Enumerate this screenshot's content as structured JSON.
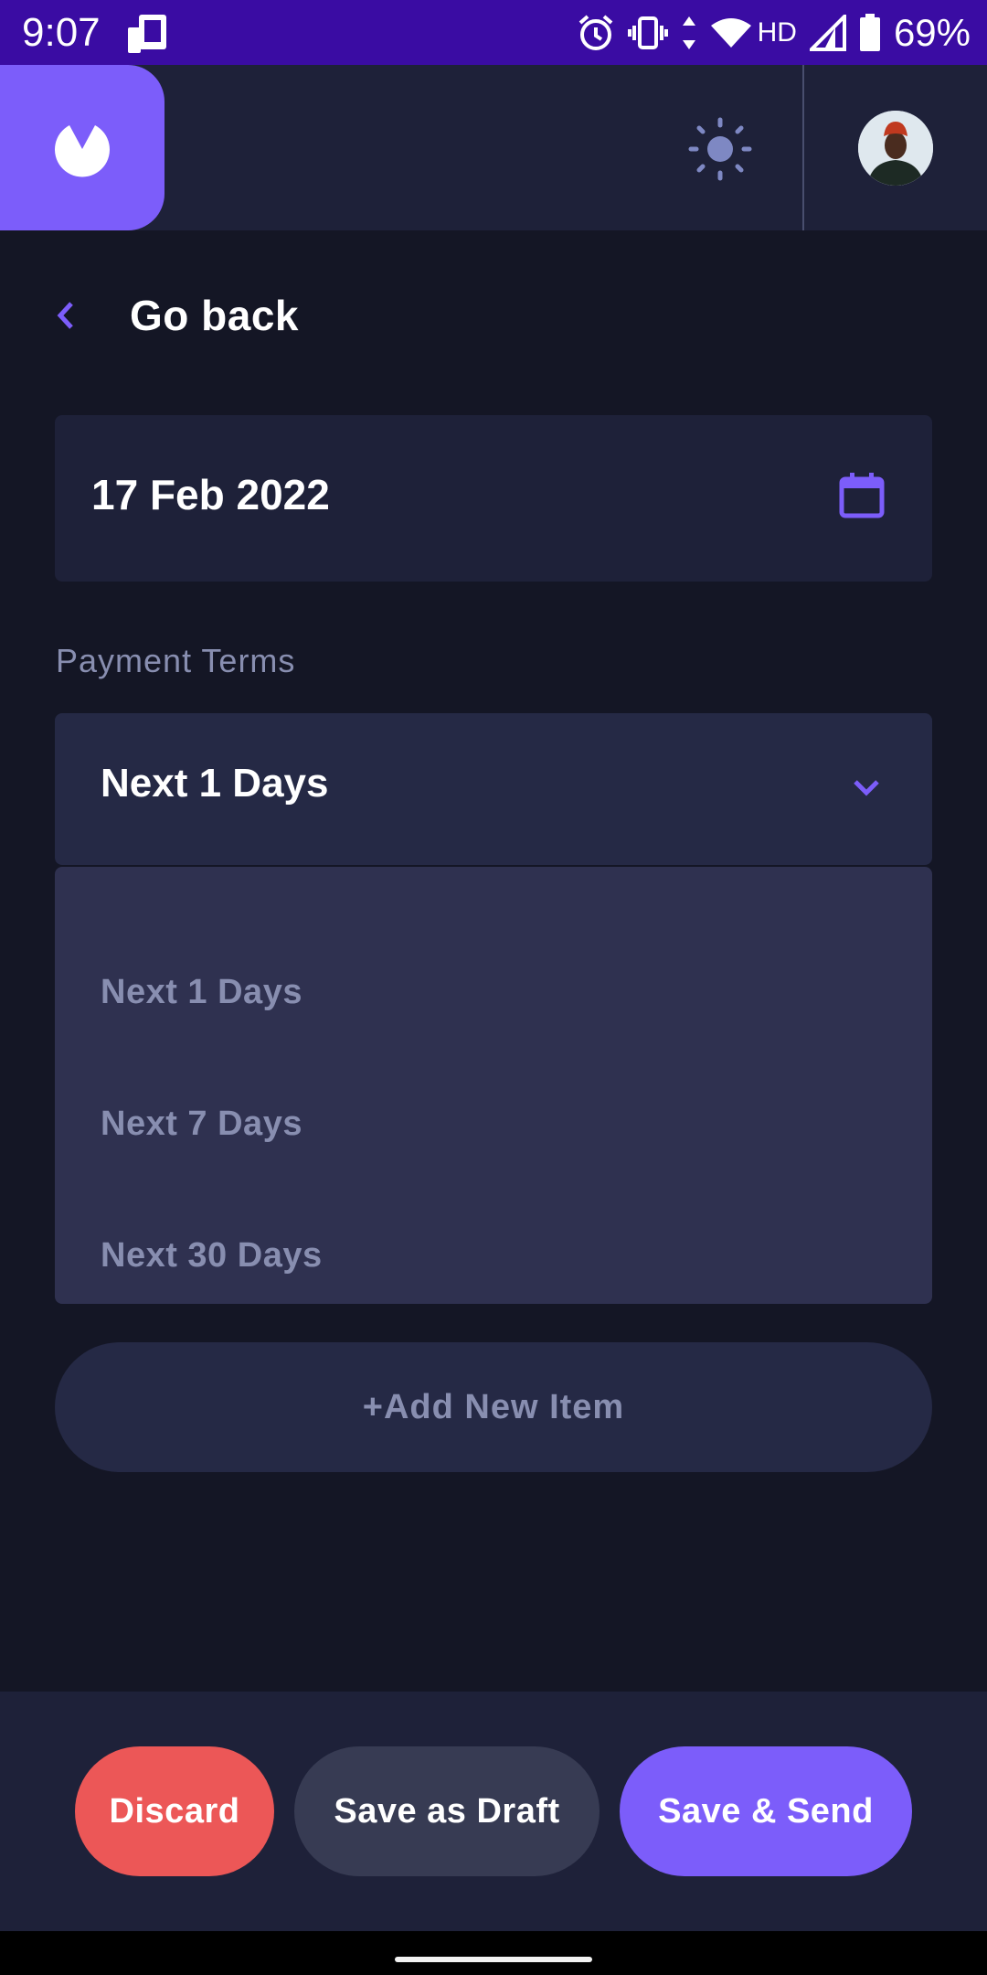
{
  "status_bar": {
    "time": "9:07",
    "network": "HD",
    "battery": "69%",
    "icons": [
      "notification-icon",
      "alarm-icon",
      "vibrate-icon",
      "data-arrows-icon",
      "wifi-icon",
      "signal-icon",
      "battery-icon"
    ]
  },
  "header": {
    "logo_icon": "app-logo-icon",
    "theme_toggle_icon": "sun-icon",
    "avatar": "user-avatar"
  },
  "nav": {
    "back_label": "Go back"
  },
  "invoice": {
    "date_value": "17 Feb 2022",
    "date_icon": "calendar-icon",
    "payment_terms_label": "Payment Terms",
    "payment_terms_selected": "Next 1 Days",
    "payment_terms_options": [
      "Next 1 Days",
      "Next 7 Days",
      "Next 30 Days"
    ],
    "add_item_label": "+Add New Item"
  },
  "actions": {
    "discard_label": "Discard",
    "draft_label": "Save as Draft",
    "send_label": "Save & Send"
  },
  "colors": {
    "accent": "#7c5dfa",
    "danger": "#ec5757",
    "background": "#141625",
    "surface": "#1e2139",
    "status_bar": "#3a0ca3"
  }
}
